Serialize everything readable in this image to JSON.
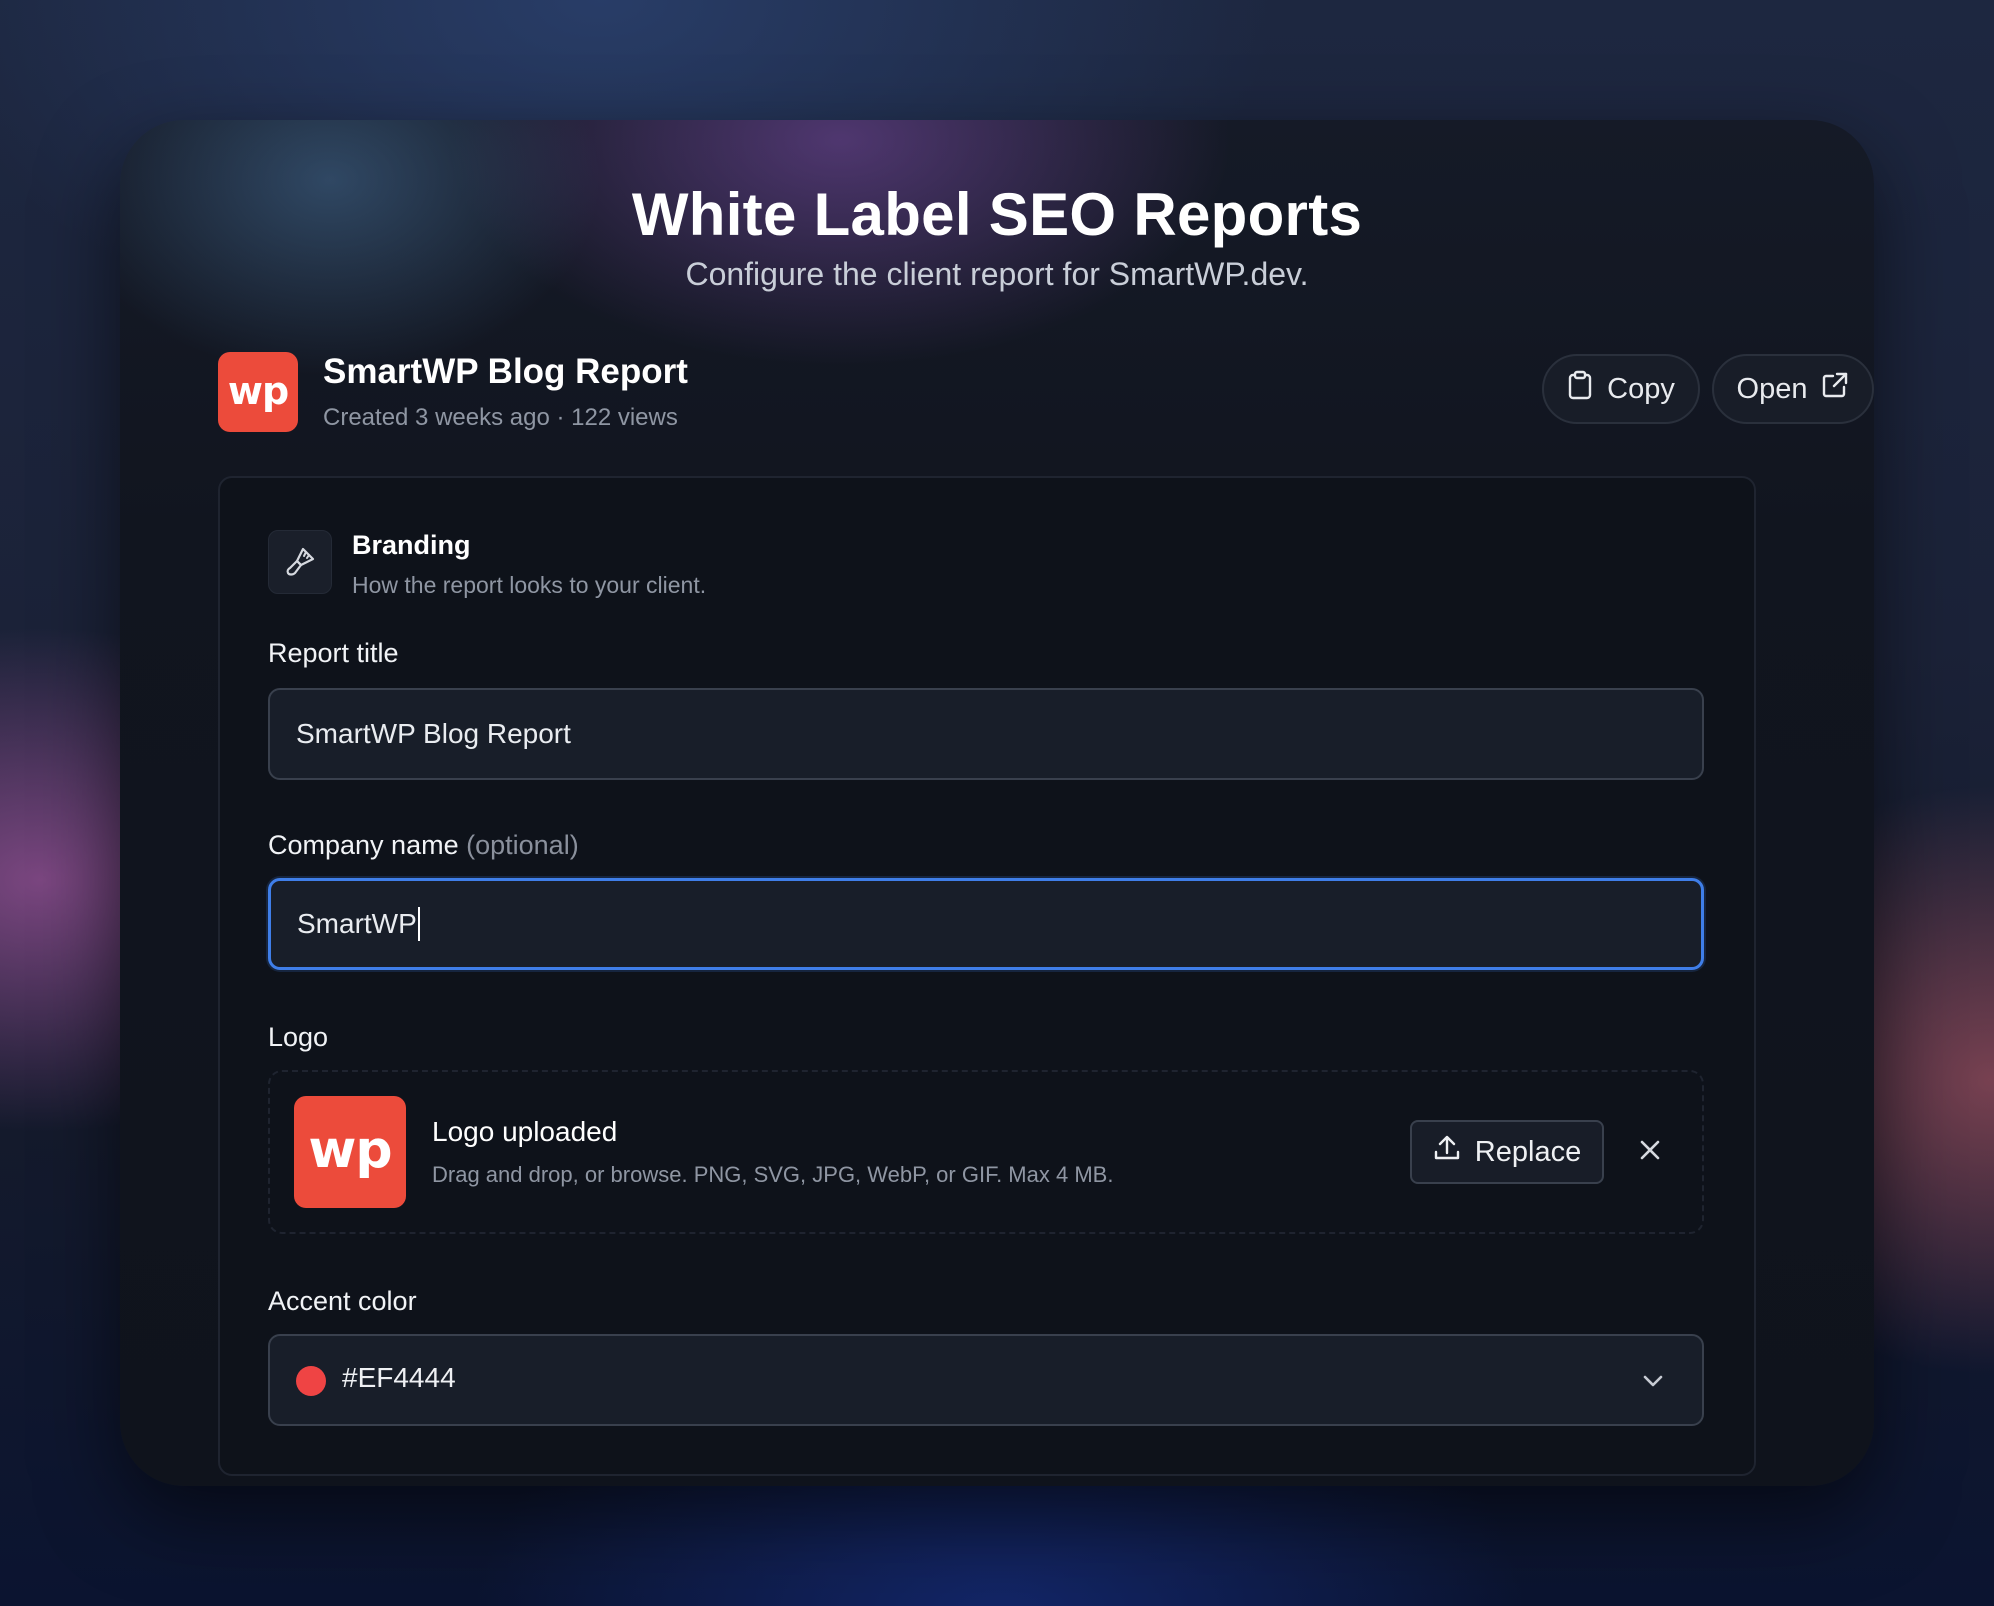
{
  "header": {
    "title": "White Label SEO Reports",
    "subtitle": "Configure the client report for SmartWP.dev."
  },
  "report": {
    "logo_text": "wp",
    "name": "SmartWP Blog Report",
    "meta": "Created 3 weeks ago · 122 views",
    "copy_label": "Copy",
    "open_label": "Open"
  },
  "branding": {
    "icon": "paintbrush-icon",
    "title": "Branding",
    "description": "How the report looks to your client."
  },
  "fields": {
    "report_title": {
      "label": "Report title",
      "value": "SmartWP Blog Report"
    },
    "company_name": {
      "label": "Company name",
      "optional": "(optional)",
      "value": "SmartWP"
    },
    "logo": {
      "label": "Logo",
      "thumb_text": "wp",
      "status": "Logo uploaded",
      "hint": "Drag and drop, or browse. PNG, SVG, JPG, WebP, or GIF. Max 4 MB.",
      "replace_label": "Replace"
    },
    "accent_color": {
      "label": "Accent color",
      "value": "#EF4444"
    }
  },
  "colors": {
    "brand": "#EC4B3B",
    "focus": "#3F7EE8",
    "accent": "#EF4444"
  }
}
